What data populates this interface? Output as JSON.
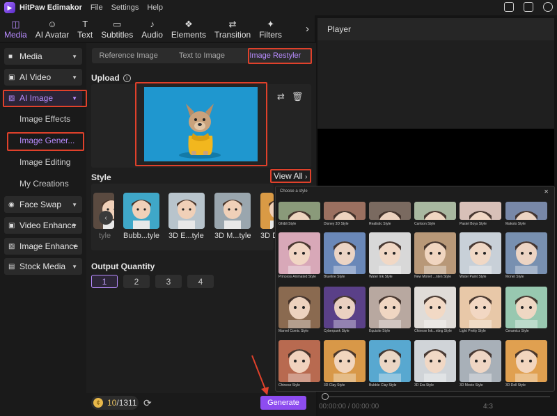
{
  "app": {
    "title": "HitPaw Edimakor",
    "menu": [
      "File",
      "Settings",
      "Help"
    ]
  },
  "toolbar": {
    "items": [
      {
        "label": "Media",
        "icon": "media-icon",
        "glyph": "◫",
        "active": true
      },
      {
        "label": "AI Avatar",
        "icon": "avatar-icon",
        "glyph": "☺",
        "active": false
      },
      {
        "label": "Text",
        "icon": "text-icon",
        "glyph": "T",
        "active": false
      },
      {
        "label": "Subtitles",
        "icon": "subtitles-icon",
        "glyph": "▭",
        "active": false
      },
      {
        "label": "Audio",
        "icon": "audio-icon",
        "glyph": "♪",
        "active": false
      },
      {
        "label": "Elements",
        "icon": "elements-icon",
        "glyph": "❖",
        "active": false
      },
      {
        "label": "Transition",
        "icon": "transition-icon",
        "glyph": "⇄",
        "active": false
      },
      {
        "label": "Filters",
        "icon": "filters-icon",
        "glyph": "✦",
        "active": false
      }
    ]
  },
  "sidebar": {
    "items": [
      {
        "label": "Media",
        "icon": "folder-icon",
        "glyph": "■",
        "active": false
      },
      {
        "label": "AI Video",
        "icon": "video-icon",
        "glyph": "▣",
        "active": false
      },
      {
        "label": "AI Image",
        "icon": "image-icon",
        "glyph": "▨",
        "active": true
      },
      {
        "label": "Face Swap",
        "icon": "face-swap-icon",
        "glyph": "◉",
        "active": false
      },
      {
        "label": "Video Enhance",
        "icon": "video-enhance-icon",
        "glyph": "▣",
        "active": false
      },
      {
        "label": "Image Enhance",
        "icon": "image-enhance-icon",
        "glyph": "▨",
        "active": false
      },
      {
        "label": "Stock Media",
        "icon": "stock-icon",
        "glyph": "▤",
        "active": false
      }
    ],
    "ai_image_sub": [
      "Image Effects",
      "Image Gener...",
      "Image Editing",
      "My Creations"
    ]
  },
  "tabs": [
    "Reference Image",
    "Text to Image",
    "Image Restyler"
  ],
  "upload": {
    "label": "Upload",
    "info": "i"
  },
  "style": {
    "label": "Style",
    "view_all": "View All",
    "strip": [
      {
        "label": "tyle",
        "bg": "#5a4a40"
      },
      {
        "label": "Bubb...tyle",
        "bg": "#3fa7c8"
      },
      {
        "label": "3D E...tyle",
        "bg": "#b8c4cc"
      },
      {
        "label": "3D M...tyle",
        "bg": "#9aa6ae"
      },
      {
        "label": "3D D",
        "bg": "#d99a45"
      }
    ]
  },
  "quantity": {
    "label": "Output Quantity",
    "options": [
      "1",
      "2",
      "3",
      "4"
    ],
    "selected": "1"
  },
  "credits": {
    "used": "10",
    "total": "/1311",
    "coin": "¢"
  },
  "generate_label": "Generate",
  "player": {
    "title": "Player",
    "time": "00:00:00 / 00:00:00",
    "aspect": "4:3"
  },
  "popup": {
    "title": "Choose a style",
    "styles": [
      {
        "label": "Ghibli Style",
        "bg": "#8a9a7a"
      },
      {
        "label": "Disney 3D Style",
        "bg": "#9b7060"
      },
      {
        "label": "Realistic Style",
        "bg": "#7a6a60"
      },
      {
        "label": "Cartoon Style",
        "bg": "#a8b8a0"
      },
      {
        "label": "Pastel Boys Style",
        "bg": "#d8c0b8"
      },
      {
        "label": "Makoto Style",
        "bg": "#7888a8"
      },
      {
        "label": "Princess Animated Style",
        "bg": "#d8a8b8"
      },
      {
        "label": "Blueline Style",
        "bg": "#6a88b8"
      },
      {
        "label": "Water Ink Style",
        "bg": "#d8d8d8"
      },
      {
        "label": "New Monet ...nten Style",
        "bg": "#b89878"
      },
      {
        "label": "Water Paint Style",
        "bg": "#c8d0d8"
      },
      {
        "label": "Monet Style",
        "bg": "#7890b0"
      },
      {
        "label": "Marvel Comic Style",
        "bg": "#8a6a50"
      },
      {
        "label": "Cyberpunk Style",
        "bg": "#5a4088"
      },
      {
        "label": "Equisite Style",
        "bg": "#b8a8a0"
      },
      {
        "label": "Chinese Ink...nting Style",
        "bg": "#e0dcd8"
      },
      {
        "label": "Light Pretty Style",
        "bg": "#e8c8a8"
      },
      {
        "label": "Ceramics Style",
        "bg": "#98c8b0"
      },
      {
        "label": "Chinese Style",
        "bg": "#b86a50"
      },
      {
        "label": "3D Clay Style",
        "bg": "#d89848"
      },
      {
        "label": "Bubble Clay Style",
        "bg": "#58a8d0"
      },
      {
        "label": "3D Era Style",
        "bg": "#d0d4d8"
      },
      {
        "label": "3D Movie Style",
        "bg": "#a8b0b8"
      },
      {
        "label": "3D Doll Style",
        "bg": "#e0a050"
      }
    ]
  },
  "colors": {
    "accent": "#b88cff",
    "generate": "#8d4cf0",
    "highlight": "#e0412b"
  }
}
